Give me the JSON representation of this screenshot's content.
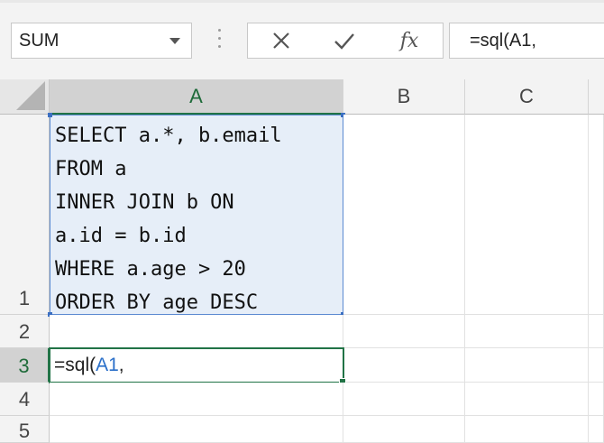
{
  "formula_bar": {
    "name_box": "SUM",
    "fx_label": "fx",
    "formula": "=sql(A1,"
  },
  "columns": [
    "A",
    "B",
    "C"
  ],
  "rows": [
    "1",
    "2",
    "3",
    "4",
    "5"
  ],
  "cells": {
    "A1": "SELECT a.*, b.email\nFROM a\nINNER JOIN b ON\na.id = b.id\nWHERE a.age > 20\nORDER BY age DESC",
    "A3": {
      "prefix": "=sql(",
      "ref": "A1",
      "suffix": ","
    }
  },
  "colors": {
    "selection_green": "#217346",
    "range_blue": "#5b8ad1",
    "ref_blue": "#2a6fc9"
  }
}
